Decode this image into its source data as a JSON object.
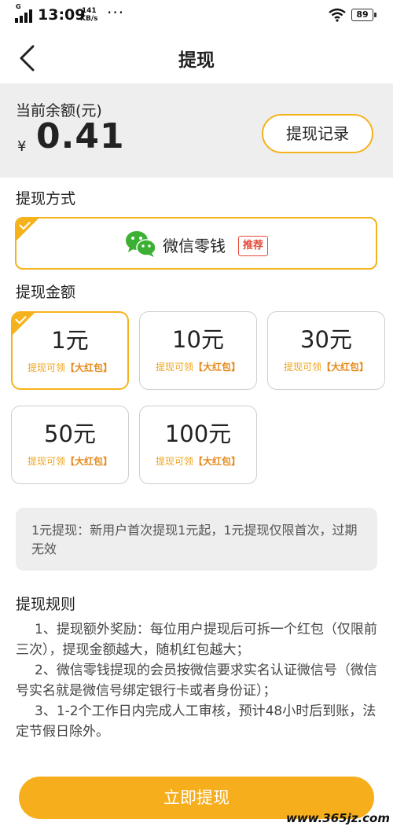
{
  "status_bar": {
    "carrier": "G",
    "time": "13:09",
    "speed_value": "141",
    "speed_unit": "KB/s",
    "menu_dots": "···",
    "battery": "89"
  },
  "header": {
    "back_icon": "chevron-left-icon",
    "title": "提现"
  },
  "balance": {
    "label": "当前余额(元)",
    "currency_symbol": "¥",
    "amount": "0.41",
    "history_button": "提现记录"
  },
  "method": {
    "section_title": "提现方式",
    "option_label": "微信零钱",
    "badge": "推荐",
    "icon": "wechat-icon",
    "selected": true
  },
  "amounts": {
    "section_title": "提现金额",
    "options": [
      {
        "value": "1元",
        "note_prefix": "提现可领",
        "note_highlight": "【大红包】",
        "selected": true
      },
      {
        "value": "10元",
        "note_prefix": "提现可领",
        "note_highlight": "【大红包】",
        "selected": false
      },
      {
        "value": "30元",
        "note_prefix": "提现可领",
        "note_highlight": "【大红包】",
        "selected": false
      },
      {
        "value": "50元",
        "note_prefix": "提现可领",
        "note_highlight": "【大红包】",
        "selected": false
      },
      {
        "value": "100元",
        "note_prefix": "提现可领",
        "note_highlight": "【大红包】",
        "selected": false
      }
    ]
  },
  "notice": "1元提现：新用户首次提现1元起，1元提现仅限首次，过期无效",
  "rules": {
    "title": "提现规则",
    "items": [
      "1、提现额外奖励：每位用户提现后可拆一个红包（仅限前三次），提现金额越大，随机红包越大；",
      "2、微信零钱提现的会员按微信要求实名认证微信号（微信号实名就是微信号绑定银行卡或者身份证）；",
      "3、1-2个工作日内完成人工审核，预计48小时后到账，法定节假日除外。"
    ]
  },
  "submit_button": "立即提现",
  "watermark": "www.365jz.com",
  "colors": {
    "accent": "#f5b21a",
    "button": "#f7ae1c",
    "badge_red": "#e34a3a",
    "panel_bg": "#eeeeee"
  }
}
